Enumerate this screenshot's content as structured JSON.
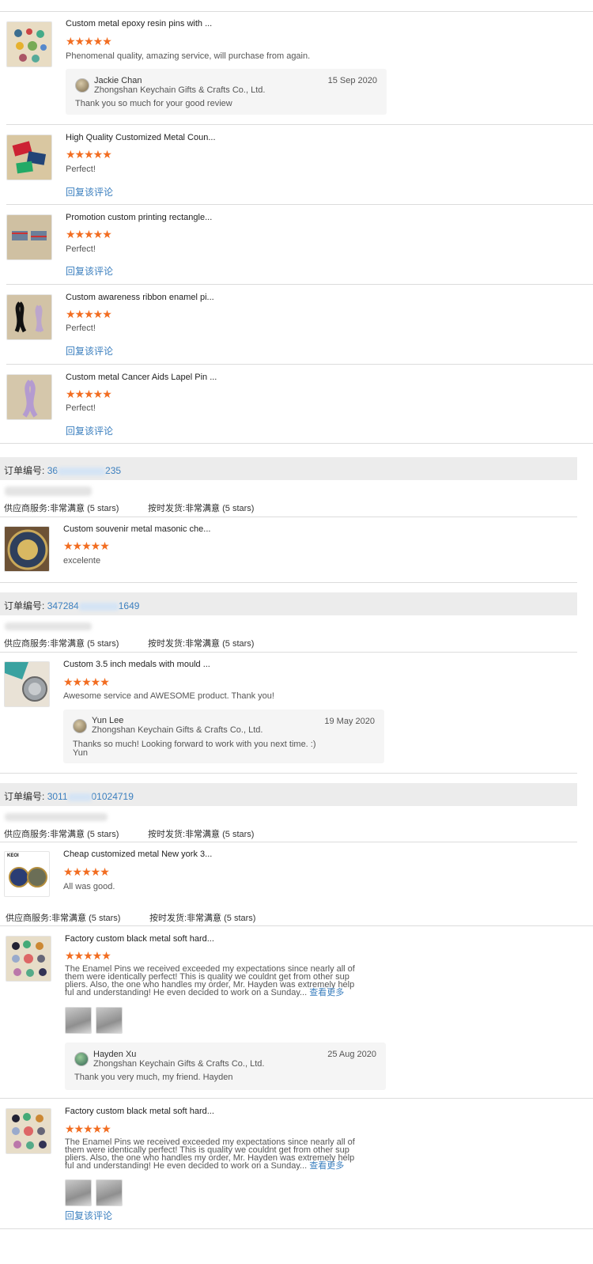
{
  "reviews_top": [
    {
      "title": "Custom metal epoxy resin pins with ...",
      "stars": "★★★★★",
      "text": "Phenomenal quality, amazing service, will purchase from again.",
      "reply": {
        "name": "Jackie Chan",
        "company": "Zhongshan Keychain Gifts & Crafts Co., Ltd.",
        "date": "15 Sep 2020",
        "message": "Thank you so much for your good review"
      }
    },
    {
      "title": "High Quality Customized Metal Coun...",
      "stars": "★★★★★",
      "text": "Perfect!",
      "reply_link": "回复该评论"
    },
    {
      "title": "Promotion custom printing rectangle...",
      "stars": "★★★★★",
      "text": "Perfect!",
      "reply_link": "回复该评论"
    },
    {
      "title": "Custom awareness ribbon enamel pi...",
      "stars": "★★★★★",
      "text": "Perfect!",
      "reply_link": "回复该评论"
    },
    {
      "title": "Custom metal Cancer Aids Lapel Pin ...",
      "stars": "★★★★★",
      "text": "Perfect!",
      "reply_link": "回复该评论"
    }
  ],
  "order1": {
    "label": "订单编号:",
    "num_start": "36",
    "num_end": "235",
    "svc_label": "供应商服务:",
    "svc_value": "非常满意",
    "svc_stars": "(5 stars)",
    "ship_label": "按时发货:",
    "ship_value": "非常满意",
    "ship_stars": "(5 stars)",
    "item": {
      "title": "Custom souvenir metal masonic che...",
      "stars": "★★★★★",
      "text": "excelente"
    }
  },
  "order2": {
    "label": "订单编号:",
    "num_start": "347284",
    "num_end": "1649",
    "svc_label": "供应商服务:",
    "svc_value": "非常满意",
    "svc_stars": "(5 stars)",
    "ship_label": "按时发货:",
    "ship_value": "非常满意",
    "ship_stars": "(5 stars)",
    "item": {
      "title": "Custom 3.5 inch medals with mould ...",
      "stars": "★★★★★",
      "text": "Awesome service and AWESOME product.  Thank you!",
      "reply": {
        "name": "Yun Lee",
        "company": "Zhongshan Keychain Gifts & Crafts Co., Ltd.",
        "date": "19 May 2020",
        "message": "Thanks so much! Looking forward to work with you next time. :)",
        "message2": "Yun"
      }
    }
  },
  "order3": {
    "label": "订单编号:",
    "num_start": "3011",
    "num_end": "01024719",
    "svc_label": "供应商服务:",
    "svc_value": "非常满意",
    "svc_stars": "(5 stars)",
    "ship_label": "按时发货:",
    "ship_value": "非常满意",
    "ship_stars": "(5 stars)",
    "item": {
      "title": "Cheap customized metal New york 3...",
      "stars": "★★★★★",
      "text": "All was good.",
      "thumb_text": "KEOI"
    },
    "svc2_label": "供应商服务:",
    "svc2_value": "非常满意",
    "svc2_stars": "(5 stars)",
    "ship2_label": "按时发货:",
    "ship2_value": "非常满意",
    "ship2_stars": "(5 stars)",
    "item2": {
      "title": "Factory custom black metal soft hard...",
      "stars": "★★★★★",
      "text_l1": "The Enamel Pins we received exceeded my expectations since nearly all of",
      "text_l2": "them were identically perfect! This is quality we couldnt get from other sup",
      "text_l3": "pliers. Also, the one who handles my order, Mr. Hayden was extremely help",
      "text_l4": "ful and understanding! He even decided to work on a Sunday...",
      "more": "查看更多",
      "reply": {
        "name": "Hayden Xu",
        "company": "Zhongshan Keychain Gifts & Crafts Co., Ltd.",
        "date": "25 Aug 2020",
        "message": "Thank you very much, my friend. Hayden"
      }
    },
    "item3": {
      "title": "Factory custom black metal soft hard...",
      "stars": "★★★★★",
      "text_l1": "The Enamel Pins we received exceeded my expectations since nearly all of",
      "text_l2": "them were identically perfect! This is quality we couldnt get from other sup",
      "text_l3": "pliers. Also, the one who handles my order, Mr. Hayden was extremely help",
      "text_l4": "ful and understanding! He even decided to work on a Sunday...",
      "more": "查看更多",
      "reply_link": "回复该评论"
    }
  }
}
